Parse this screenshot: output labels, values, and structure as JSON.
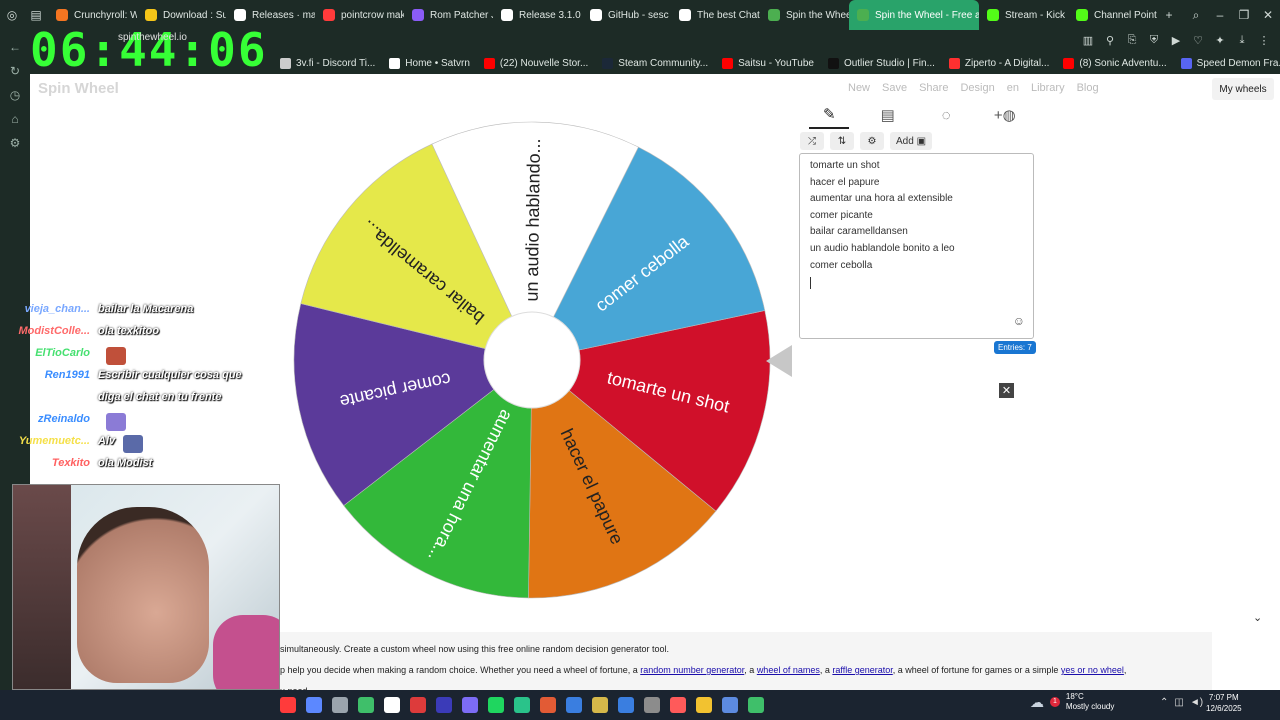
{
  "browser": {
    "tabs": [
      {
        "label": "Crunchyroll: W",
        "color": "#f47521"
      },
      {
        "label": "Download : Su",
        "color": "#f5c518"
      },
      {
        "label": "Releases · mar",
        "color": "#ffffff"
      },
      {
        "label": "pointcrow mak",
        "color": "#ff3b3b"
      },
      {
        "label": "Rom Patcher J",
        "color": "#8b5cf6"
      },
      {
        "label": "Release 3.1.0",
        "color": "#ffffff"
      },
      {
        "label": "GitHub - sesc",
        "color": "#ffffff"
      },
      {
        "label": "The best Chat",
        "color": "#ffffff"
      },
      {
        "label": "Spin the Whee",
        "color": "#4caf50"
      },
      {
        "label": "Spin the Wheel - Free an",
        "color": "#4caf50",
        "active": true
      },
      {
        "label": "Stream - Kick",
        "color": "#53fc18"
      },
      {
        "label": "Channel Points",
        "color": "#53fc18"
      }
    ],
    "url": "spinthewheel.io",
    "bookmarks": [
      {
        "label": "3v.fi - Discord Ti...",
        "color": "#cccccc"
      },
      {
        "label": "Home • Satvrn",
        "color": "#ffffff"
      },
      {
        "label": "(22) Nouvelle Stor...",
        "color": "#ff0000"
      },
      {
        "label": "Steam Community...",
        "color": "#1b2838"
      },
      {
        "label": "Saitsu - YouTube",
        "color": "#ff0000"
      },
      {
        "label": "Outlier Studio | Fin...",
        "color": "#111111"
      },
      {
        "label": "Ziperto - A Digital...",
        "color": "#ff3030"
      },
      {
        "label": "(8) Sonic Adventu...",
        "color": "#ff0000"
      },
      {
        "label": "Speed Demon Fra...",
        "color": "#5865f2"
      }
    ]
  },
  "overlay_clock": "06:44:06",
  "app": {
    "logo": "Spin Wheel",
    "toolbar": [
      "New",
      "Save",
      "Share",
      "Design",
      "en",
      "Library",
      "Blog"
    ],
    "my_wheels": "My wheels"
  },
  "wheel": {
    "segments": [
      {
        "label": "tomarte un shot",
        "color": "#d0102a"
      },
      {
        "label": "hacer el papure",
        "color": "#e07514"
      },
      {
        "label": "aumentar una hora...",
        "color": "#33b83a"
      },
      {
        "label": "comer picante",
        "color": "#5b3a9a"
      },
      {
        "label": "bailar caramellda...",
        "color": "#e5e84a"
      },
      {
        "label": "un audio hablando...",
        "color": "#ffffff"
      },
      {
        "label": "comer cebolla",
        "color": "#48a6d6"
      }
    ]
  },
  "panel": {
    "tabs": [
      "edit-icon",
      "clipboard-icon",
      "hide-icon",
      "add-color-icon"
    ],
    "add_button": "Add",
    "entries": [
      "tomarte un shot",
      "hacer el papure",
      "aumentar una hora al extensible",
      "comer picante",
      "bailar caramelldansen",
      "un audio hablandole bonito a leo",
      "comer cebolla"
    ],
    "entries_count": "Entries: 7"
  },
  "description": {
    "line1": "simultaneously. Create a custom wheel now using this free online random decision generator tool.",
    "line2_prefix": "p help you decide when making a random choice. Whether you need a wheel of fortune, a ",
    "link1": "random number generator",
    "mid1": ", a ",
    "link2": "wheel of names",
    "mid2": ", a ",
    "link3": "raffle generator",
    "mid3": ", a wheel of fortune for games or a simple ",
    "link4": "yes or no wheel",
    "suffix": ",",
    "line3": "u need."
  },
  "chat": [
    {
      "user": "vieja_chan...",
      "msg": "bailar la Macarena",
      "color": "#7aa8ff"
    },
    {
      "user": "ModistColle...",
      "msg": "ola texkitoo",
      "color": "#ff6a6a"
    },
    {
      "user": "ElTioCarlo",
      "msg": "",
      "color": "#46e070",
      "emote": "#c0503a"
    },
    {
      "user": "Ren1991",
      "msg": "Escribir cualquier cosa que",
      "color": "#3a8dff"
    },
    {
      "user": "",
      "msg": "diga el chat en tu frente",
      "color": "#3a8dff"
    },
    {
      "user": "zReinaldo",
      "msg": "",
      "color": "#3a8dff",
      "emote": "#8b7bd6"
    },
    {
      "user": "Yumemuetc...",
      "msg": "Alv",
      "color": "#f5e04a",
      "emote": "#5a6aa8"
    },
    {
      "user": "Texkito",
      "msg": "ola Modist",
      "color": "#ff6060"
    }
  ],
  "taskbar": {
    "icons": [
      "#ff3b3b",
      "#5c88ff",
      "#9aa4ad",
      "#3fbf6a",
      "#ffffff",
      "#dd3b3b",
      "#3b3bb8",
      "#7c6cf5",
      "#1fd65f",
      "#2ac38a",
      "#e25b35",
      "#3a7ee0",
      "#d6b84a",
      "#3a7ee0",
      "#8c8c8c",
      "#ff5a5a",
      "#f2c230",
      "#5d8be0",
      "#3fbf6a"
    ],
    "weather_temp": "18°C",
    "weather_desc": "Mostly cloudy",
    "weather_badge": "1",
    "time": "7:07 PM",
    "date": "12/6/2025"
  }
}
